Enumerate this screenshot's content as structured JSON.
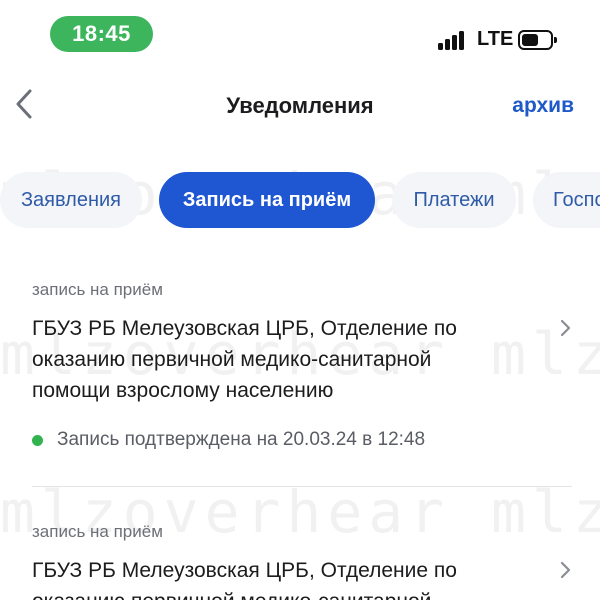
{
  "status_bar": {
    "time": "18:45",
    "network": "LTE",
    "icons": [
      "signal-bars-icon",
      "battery-icon"
    ]
  },
  "nav": {
    "back_icon": "chevron-left-icon",
    "title": "Уведомления",
    "archive_label": "архив"
  },
  "tabs": [
    {
      "label": "Заявления",
      "active": false
    },
    {
      "label": "Запись на приём",
      "active": true
    },
    {
      "label": "Платежи",
      "active": false
    },
    {
      "label": "Госпо",
      "active": false
    }
  ],
  "notifications": [
    {
      "category": "запись на приём",
      "title_lines": [
        "ГБУЗ РБ Мелеузовская ЦРБ, Отделение по",
        "оказанию первичной медико-санитарной",
        "помощи взрослому населению"
      ],
      "status": "Запись подтверждена на 20.03.24 в 12:48",
      "status_color": "#33b34f"
    },
    {
      "category": "запись на приём",
      "title_lines": [
        "ГБУЗ РБ Мелеузовская ЦРБ, Отделение по",
        "оказанию первичной медико-санитарной"
      ]
    }
  ],
  "watermark": "mlzoverhear",
  "colors": {
    "accent": "#1f56d2",
    "time_pill": "#3cb55c",
    "link": "#1f58c9"
  }
}
